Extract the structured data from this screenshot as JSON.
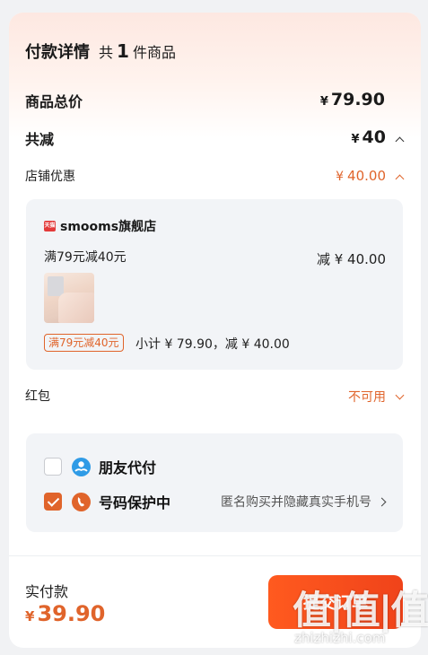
{
  "header": {
    "title": "付款详情",
    "count_prefix": "共",
    "count": "1",
    "count_suffix": "件商品"
  },
  "summary": {
    "total_label": "商品总价",
    "total_currency": "¥",
    "total_value": "79.90",
    "discount_label": "共减",
    "discount_currency": "¥",
    "discount_value": "40"
  },
  "store_discount": {
    "label": "店铺优惠",
    "currency": "¥",
    "value": "40.00"
  },
  "store_card": {
    "badge": "天猫",
    "store_name": "smooms旗舰店",
    "promo": "满79元减40元",
    "promo_amount": "减 ¥ 40.00",
    "tag": "满79元减40元",
    "subtotal": "小计 ¥ 79.90，减 ¥ 40.00"
  },
  "red_packet": {
    "label": "红包",
    "status": "不可用"
  },
  "options": {
    "friend_pay": {
      "label": "朋友代付",
      "checked": false
    },
    "number_protect": {
      "label": "号码保护中",
      "desc": "匿名购买并隐藏真实手机号",
      "checked": true
    }
  },
  "footer": {
    "pay_label": "实付款",
    "pay_currency": "¥",
    "pay_value": "39.90",
    "submit_label": "提交订单"
  },
  "watermark": {
    "big": "值|值|值",
    "small": "zhizhizhi.com"
  },
  "colors": {
    "accent": "#e0642b",
    "button": "#f0431a",
    "card_bg": "#f2f4f7",
    "friend_icon": "#2f9be6",
    "protect_icon": "#e0642b"
  }
}
